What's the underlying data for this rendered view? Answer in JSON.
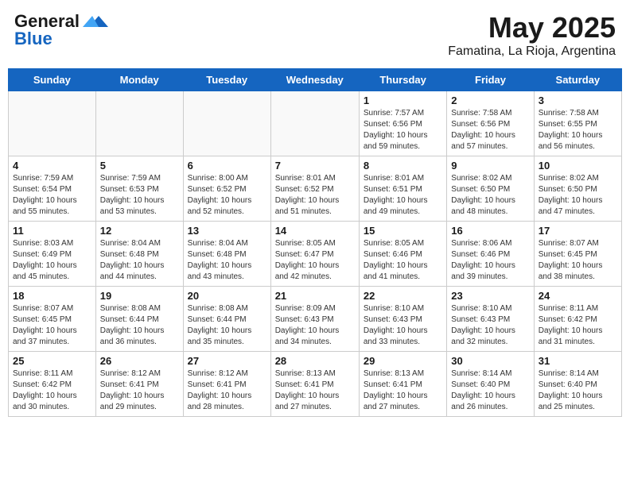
{
  "header": {
    "logo_line1": "General",
    "logo_line2": "Blue",
    "title": "May 2025",
    "subtitle": "Famatina, La Rioja, Argentina"
  },
  "days_of_week": [
    "Sunday",
    "Monday",
    "Tuesday",
    "Wednesday",
    "Thursday",
    "Friday",
    "Saturday"
  ],
  "weeks": [
    [
      {
        "day": "",
        "info": ""
      },
      {
        "day": "",
        "info": ""
      },
      {
        "day": "",
        "info": ""
      },
      {
        "day": "",
        "info": ""
      },
      {
        "day": "1",
        "info": "Sunrise: 7:57 AM\nSunset: 6:56 PM\nDaylight: 10 hours\nand 59 minutes."
      },
      {
        "day": "2",
        "info": "Sunrise: 7:58 AM\nSunset: 6:56 PM\nDaylight: 10 hours\nand 57 minutes."
      },
      {
        "day": "3",
        "info": "Sunrise: 7:58 AM\nSunset: 6:55 PM\nDaylight: 10 hours\nand 56 minutes."
      }
    ],
    [
      {
        "day": "4",
        "info": "Sunrise: 7:59 AM\nSunset: 6:54 PM\nDaylight: 10 hours\nand 55 minutes."
      },
      {
        "day": "5",
        "info": "Sunrise: 7:59 AM\nSunset: 6:53 PM\nDaylight: 10 hours\nand 53 minutes."
      },
      {
        "day": "6",
        "info": "Sunrise: 8:00 AM\nSunset: 6:52 PM\nDaylight: 10 hours\nand 52 minutes."
      },
      {
        "day": "7",
        "info": "Sunrise: 8:01 AM\nSunset: 6:52 PM\nDaylight: 10 hours\nand 51 minutes."
      },
      {
        "day": "8",
        "info": "Sunrise: 8:01 AM\nSunset: 6:51 PM\nDaylight: 10 hours\nand 49 minutes."
      },
      {
        "day": "9",
        "info": "Sunrise: 8:02 AM\nSunset: 6:50 PM\nDaylight: 10 hours\nand 48 minutes."
      },
      {
        "day": "10",
        "info": "Sunrise: 8:02 AM\nSunset: 6:50 PM\nDaylight: 10 hours\nand 47 minutes."
      }
    ],
    [
      {
        "day": "11",
        "info": "Sunrise: 8:03 AM\nSunset: 6:49 PM\nDaylight: 10 hours\nand 45 minutes."
      },
      {
        "day": "12",
        "info": "Sunrise: 8:04 AM\nSunset: 6:48 PM\nDaylight: 10 hours\nand 44 minutes."
      },
      {
        "day": "13",
        "info": "Sunrise: 8:04 AM\nSunset: 6:48 PM\nDaylight: 10 hours\nand 43 minutes."
      },
      {
        "day": "14",
        "info": "Sunrise: 8:05 AM\nSunset: 6:47 PM\nDaylight: 10 hours\nand 42 minutes."
      },
      {
        "day": "15",
        "info": "Sunrise: 8:05 AM\nSunset: 6:46 PM\nDaylight: 10 hours\nand 41 minutes."
      },
      {
        "day": "16",
        "info": "Sunrise: 8:06 AM\nSunset: 6:46 PM\nDaylight: 10 hours\nand 39 minutes."
      },
      {
        "day": "17",
        "info": "Sunrise: 8:07 AM\nSunset: 6:45 PM\nDaylight: 10 hours\nand 38 minutes."
      }
    ],
    [
      {
        "day": "18",
        "info": "Sunrise: 8:07 AM\nSunset: 6:45 PM\nDaylight: 10 hours\nand 37 minutes."
      },
      {
        "day": "19",
        "info": "Sunrise: 8:08 AM\nSunset: 6:44 PM\nDaylight: 10 hours\nand 36 minutes."
      },
      {
        "day": "20",
        "info": "Sunrise: 8:08 AM\nSunset: 6:44 PM\nDaylight: 10 hours\nand 35 minutes."
      },
      {
        "day": "21",
        "info": "Sunrise: 8:09 AM\nSunset: 6:43 PM\nDaylight: 10 hours\nand 34 minutes."
      },
      {
        "day": "22",
        "info": "Sunrise: 8:10 AM\nSunset: 6:43 PM\nDaylight: 10 hours\nand 33 minutes."
      },
      {
        "day": "23",
        "info": "Sunrise: 8:10 AM\nSunset: 6:43 PM\nDaylight: 10 hours\nand 32 minutes."
      },
      {
        "day": "24",
        "info": "Sunrise: 8:11 AM\nSunset: 6:42 PM\nDaylight: 10 hours\nand 31 minutes."
      }
    ],
    [
      {
        "day": "25",
        "info": "Sunrise: 8:11 AM\nSunset: 6:42 PM\nDaylight: 10 hours\nand 30 minutes."
      },
      {
        "day": "26",
        "info": "Sunrise: 8:12 AM\nSunset: 6:41 PM\nDaylight: 10 hours\nand 29 minutes."
      },
      {
        "day": "27",
        "info": "Sunrise: 8:12 AM\nSunset: 6:41 PM\nDaylight: 10 hours\nand 28 minutes."
      },
      {
        "day": "28",
        "info": "Sunrise: 8:13 AM\nSunset: 6:41 PM\nDaylight: 10 hours\nand 27 minutes."
      },
      {
        "day": "29",
        "info": "Sunrise: 8:13 AM\nSunset: 6:41 PM\nDaylight: 10 hours\nand 27 minutes."
      },
      {
        "day": "30",
        "info": "Sunrise: 8:14 AM\nSunset: 6:40 PM\nDaylight: 10 hours\nand 26 minutes."
      },
      {
        "day": "31",
        "info": "Sunrise: 8:14 AM\nSunset: 6:40 PM\nDaylight: 10 hours\nand 25 minutes."
      }
    ]
  ]
}
